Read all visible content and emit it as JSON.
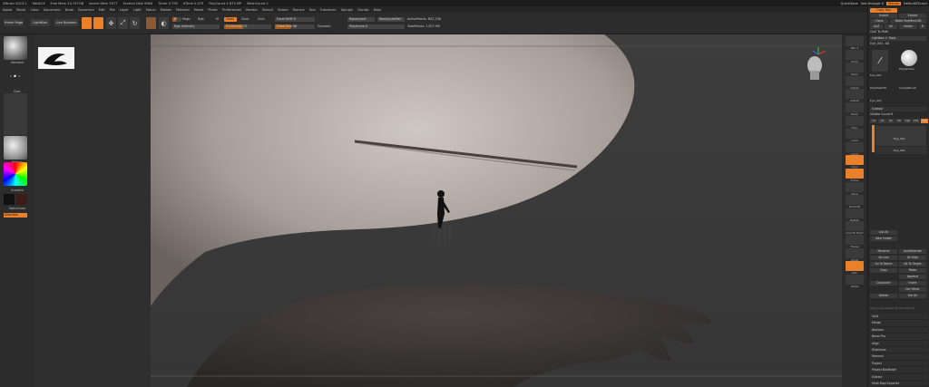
{
  "titlebar": {
    "app": "ZBrush 2023.1",
    "doc": "Malik23",
    "free_mem": "Free Mem 13.797GB",
    "active_mem": "Active Mem 3577",
    "scratch": "Scratch Disk 9964",
    "timer": "Timer 0.795",
    "atime": "ATime 0.073",
    "polycount": "PolyCount 1.675 MP",
    "meshcount": "MeshCount 2",
    "quicksave": "QuickSave",
    "seethrough": "See-through 0",
    "menus": "Menus",
    "default_zscript": "DefaultZScript"
  },
  "menubar": {
    "items": [
      "Alpha",
      "Brush",
      "Color",
      "Document",
      "Draw",
      "Dynamics",
      "Edit",
      "File",
      "Layer",
      "Light",
      "Macro",
      "Marker",
      "Material",
      "Movie",
      "Picker",
      "Preferences",
      "Render",
      "Stencil",
      "Stroke",
      "Texture",
      "Tool",
      "Transform",
      "Zplugin",
      "Zscript",
      "Help"
    ]
  },
  "topshelf": {
    "home_page": "Home Page",
    "lightbox": "LightBox",
    "live_boolean": "Live Boolean",
    "edit": "Edit",
    "draw": "Draw",
    "move": "Move",
    "scale": "Scale",
    "rotate": "Rotate",
    "mrgb": "Mrgb",
    "rgb": "Rgb",
    "m": "M",
    "zadd": "Zadd",
    "zsub": "Zsub",
    "zcut": "Zcut",
    "rgb_intensity": "Rgb Intensity",
    "z_intensity": "Z Intensity 25",
    "focal_shift": "Focal Shift 0",
    "draw_size": "Draw Size 68",
    "dynamic": "Dynamic",
    "replay_last": "ReplayLast",
    "replay_last_rel": "ReplayLastRel",
    "active_points": "ActivePoints: 852,236",
    "total_points": "TotalPoints: 1.671 Mil",
    "polyframe": "Polyframe 0"
  },
  "leftshelf": {
    "brush_label": "Standard",
    "stroke_label": "Dots",
    "alpha_label": "Alpha Off",
    "texture_label": "Texture Off",
    "material_label": "Matcap",
    "gradient_label": "Gradient",
    "switch_color": "SwitchColor",
    "alternate": "Alternate"
  },
  "toolpanel": {
    "header": "Copy Tool",
    "import": "Import",
    "export": "Export",
    "clone": "Clone",
    "make_polymesh": "Make PolyMesh3D",
    "goz": "GoZ",
    "all": "All",
    "visible": "Visible",
    "r": "R",
    "goz_path": "GoZ To Path",
    "lightbox_tools": "Lightbox > Tools",
    "current_tool": "Eye_001. 48",
    "tool_items": [
      "Eye_001",
      "PolySphere",
      "Eye_001",
      "PolyMesh3D",
      "SimpleBrush",
      "ZSphere",
      "Eye_001"
    ],
    "subtool_header": "Subtool",
    "visible_count": "Visible Count 8",
    "v_buttons": [
      "V1",
      "V2",
      "V4",
      "V8",
      "V16",
      "V32",
      "V64"
    ],
    "subtool_items": [
      "Eye_001",
      "Eye_001"
    ],
    "list_all": "List All",
    "new_folder": "New Folder",
    "rename": "Rename",
    "auto_reorder": "AutoReorder",
    "all_low": "All Low",
    "all_high": "All High",
    "all_to_name": "All To Name",
    "all_to_target": "All To Target",
    "copy": "Copy",
    "paste": "Paste",
    "duplicate": "Duplicate",
    "append": "Append",
    "insert": "Insert",
    "delete": "Delete",
    "del_other": "Del Other",
    "del_all": "Del All",
    "apply_pair": "Apply suppressed To All Subtools",
    "menu_items": [
      "Split",
      "Merge",
      "Boolean",
      "Bevel Pro",
      "Align",
      "Distribute",
      "Remesh",
      "Project",
      "Project BasRelief",
      "Extract",
      "Multi Map Exporter"
    ]
  },
  "rightshelf": {
    "labels": [
      "SPix 3",
      "Scroll",
      "Zoom",
      "Actual",
      "AAHalf",
      "Persp",
      "Floor",
      "Local",
      "L.Sym",
      "Gxyz",
      "Frame",
      "Move",
      "Zoom3D",
      "Rotate",
      "Line Fill PolyF",
      "Transp",
      "Ghost",
      "Solo",
      "Xpose"
    ]
  },
  "colors": {
    "accent": "#e8812a",
    "panel": "#2c2c2c",
    "canvas": "#3b3b3b"
  }
}
